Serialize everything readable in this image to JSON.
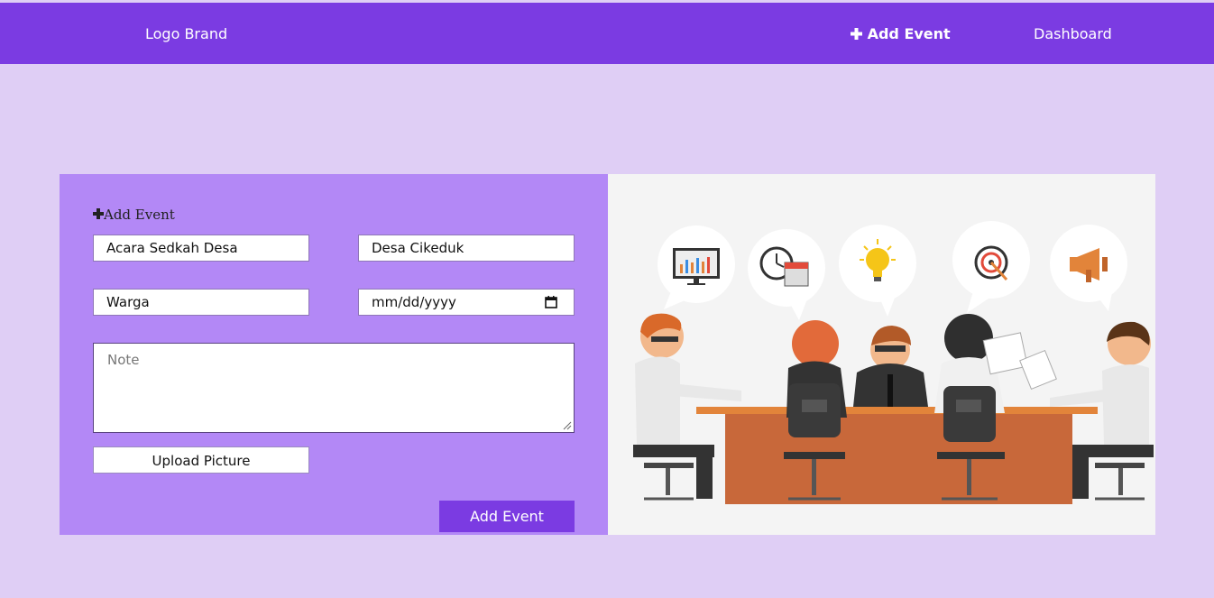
{
  "nav": {
    "brand": "Logo Brand",
    "add_event": "Add Event",
    "add_event_icon": "plus-icon",
    "dashboard": "Dashboard"
  },
  "form": {
    "title": "Add Event",
    "title_icon": "plus-icon",
    "event_name": "Acara Sedkah Desa",
    "location": "Desa Cikeduk",
    "participants": "Warga",
    "date_placeholder": "mm/dd/yyyy",
    "note_placeholder": "Note",
    "upload_label": "Upload Picture",
    "submit_label": "Add Event"
  },
  "colors": {
    "navbar": "#7b3be2",
    "page_bg": "#dfcef5",
    "form_panel": "#b388f6",
    "button": "#7b3be2"
  }
}
